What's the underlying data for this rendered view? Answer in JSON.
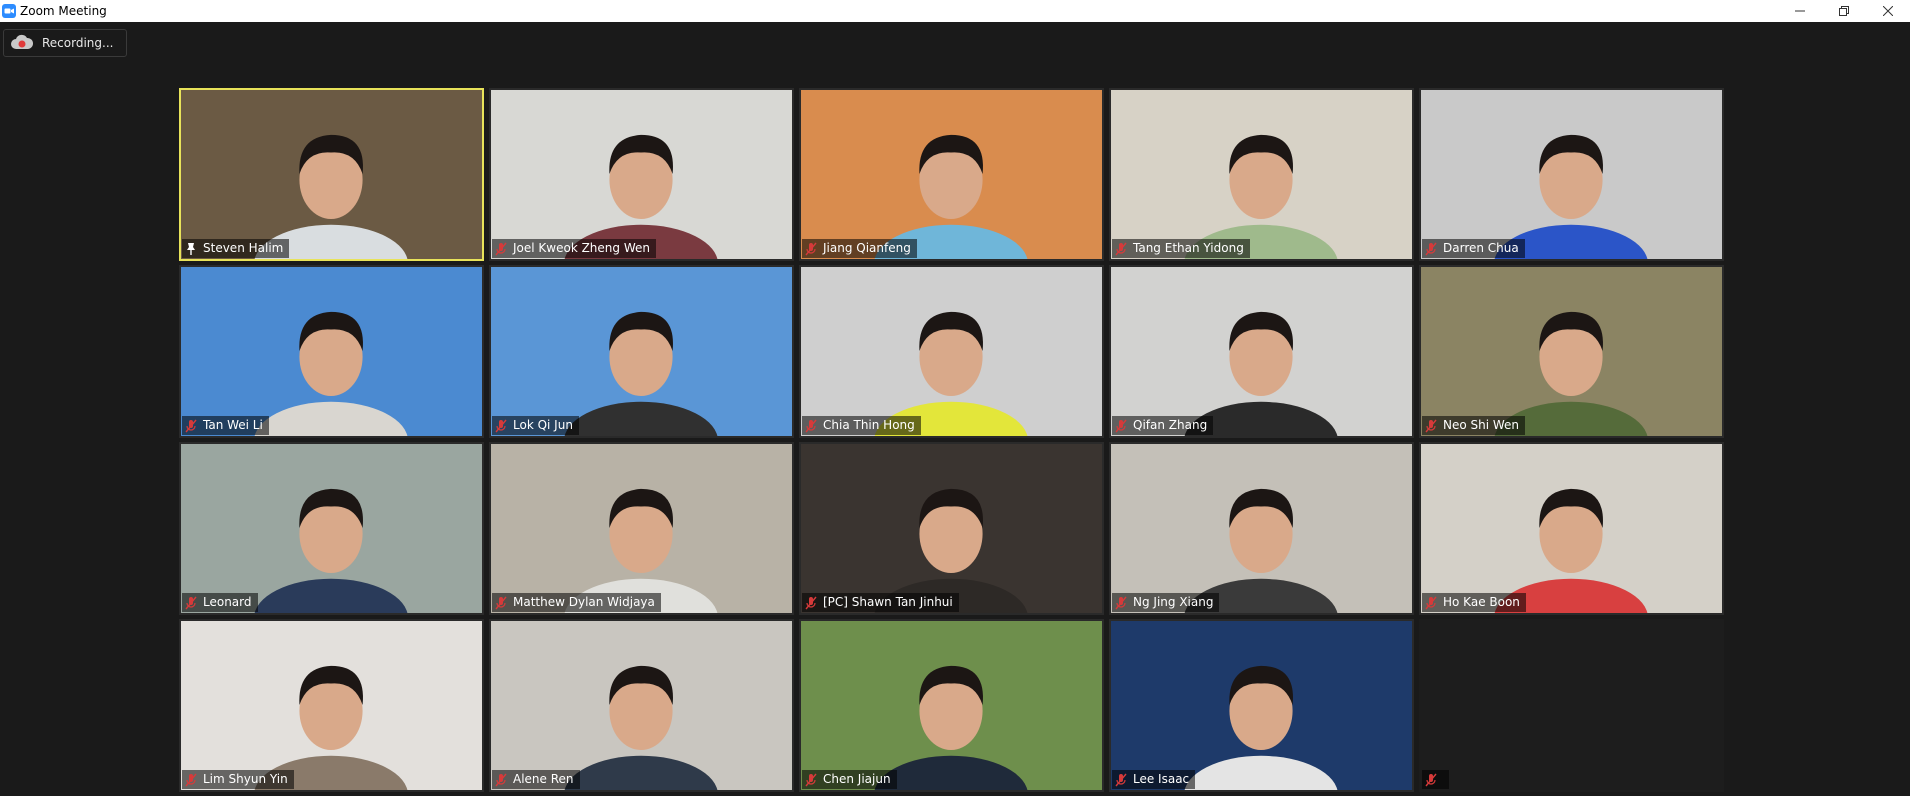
{
  "window": {
    "title": "Zoom Meeting"
  },
  "recording": {
    "label": "Recording..."
  },
  "participants": [
    {
      "name": "Steven Halim",
      "status": "pinned",
      "bg": "#6b5a44",
      "shirt": "#d9dde0"
    },
    {
      "name": "Joel Kweok Zheng Wen",
      "status": "muted",
      "bg": "#d8d8d4",
      "shirt": "#7a3a40"
    },
    {
      "name": "Jiang Qianfeng",
      "status": "muted",
      "bg": "#d98c4e",
      "shirt": "#6fb6d9"
    },
    {
      "name": "Tang Ethan Yidong",
      "status": "muted",
      "bg": "#d7d2c6",
      "shirt": "#9fba8c"
    },
    {
      "name": "Darren Chua",
      "status": "muted",
      "bg": "#c9c9c9",
      "shirt": "#2b55c8"
    },
    {
      "name": "Tan Wei Li",
      "status": "muted",
      "bg": "#4b8ad1",
      "shirt": "#d9d6d0"
    },
    {
      "name": "Lok Qi Jun",
      "status": "muted",
      "bg": "#5a96d6",
      "shirt": "#303030"
    },
    {
      "name": "Chia Thin Hong",
      "status": "muted",
      "bg": "#cfcfcf",
      "shirt": "#e3e63a"
    },
    {
      "name": "Qifan Zhang",
      "status": "muted",
      "bg": "#d2d2d0",
      "shirt": "#2a2a2a"
    },
    {
      "name": "Neo Shi Wen",
      "status": "muted",
      "bg": "#8b8463",
      "shirt": "#556b3a"
    },
    {
      "name": "Leonard",
      "status": "muted",
      "bg": "#9aa6a0",
      "shirt": "#2a3b5a"
    },
    {
      "name": "Matthew Dylan Widjaya",
      "status": "muted",
      "bg": "#b8b2a6",
      "shirt": "#e0e0dc"
    },
    {
      "name": "[PC] Shawn Tan Jinhui",
      "status": "muted",
      "bg": "#3a3430",
      "shirt": "#2d2926"
    },
    {
      "name": "Ng Jing Xiang",
      "status": "muted",
      "bg": "#c4c0b8",
      "shirt": "#3a3a3a"
    },
    {
      "name": "Ho Kae Boon",
      "status": "muted",
      "bg": "#d4d0c8",
      "shirt": "#d84040"
    },
    {
      "name": "Lim Shyun Yin",
      "status": "muted",
      "bg": "#e3e0dc",
      "shirt": "#8a7a6a"
    },
    {
      "name": "Alene Ren",
      "status": "muted",
      "bg": "#c9c6c0",
      "shirt": "#2f3a4a"
    },
    {
      "name": "Chen Jiajun",
      "status": "muted",
      "bg": "#6e8f4c",
      "shirt": "#1f2a3a"
    },
    {
      "name": "Lee Isaac",
      "status": "muted",
      "bg": "#1e3a6a",
      "shirt": "#e4e4e4"
    },
    {
      "name": "",
      "status": "muted",
      "bg": "#1d1d1d",
      "shirt": "#1d1d1d"
    }
  ],
  "colors": {
    "active_speaker_border": "#e8e35a",
    "muted_icon": "#d63a3a",
    "background": "#1a1a1a"
  }
}
